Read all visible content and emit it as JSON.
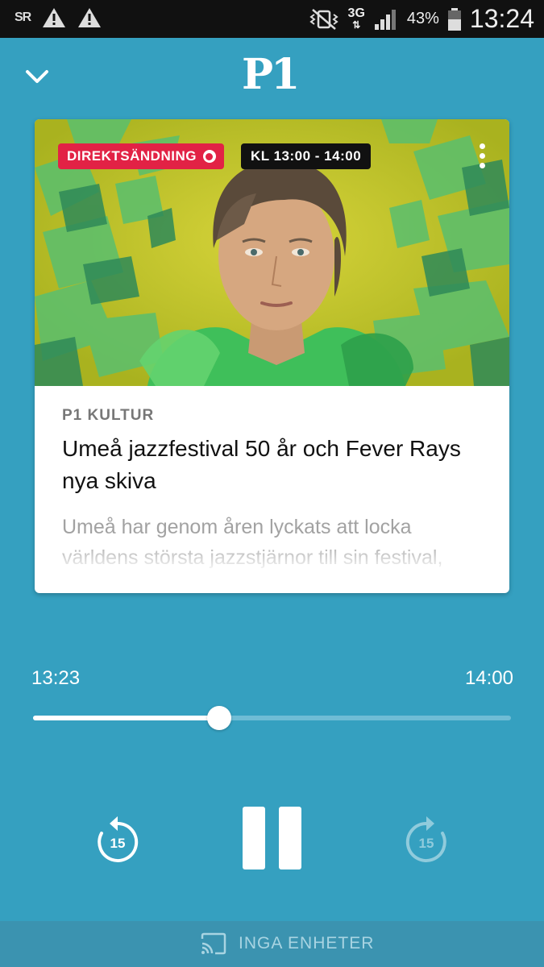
{
  "status_bar": {
    "left_icons": [
      "sr-app-icon",
      "warning-icon",
      "warning-icon"
    ],
    "sr_label": "SR",
    "network": "3G",
    "battery": "43%",
    "time": "13:24"
  },
  "app_bar": {
    "logo": "P1",
    "collapse_icon": "chevron-down-icon"
  },
  "episode": {
    "live_label": "DIREKTSÄNDNING",
    "time_range": "KL 13:00 - 14:00",
    "channel": "P1 KULTUR",
    "title": "Umeå jazzfestival 50 år och Fever Rays nya skiva",
    "description": "Umeå har genom åren lyckats att locka världens största jazzstjärnor till sin festival,"
  },
  "player": {
    "current_time": "13:23",
    "end_time": "14:00",
    "progress_fraction": 0.39,
    "rewind_seconds": "15",
    "forward_seconds": "15"
  },
  "cast": {
    "label": "INGA ENHETER",
    "icon": "cast-icon"
  },
  "colors": {
    "background": "#35a0c0",
    "live_red": "#e22245"
  }
}
